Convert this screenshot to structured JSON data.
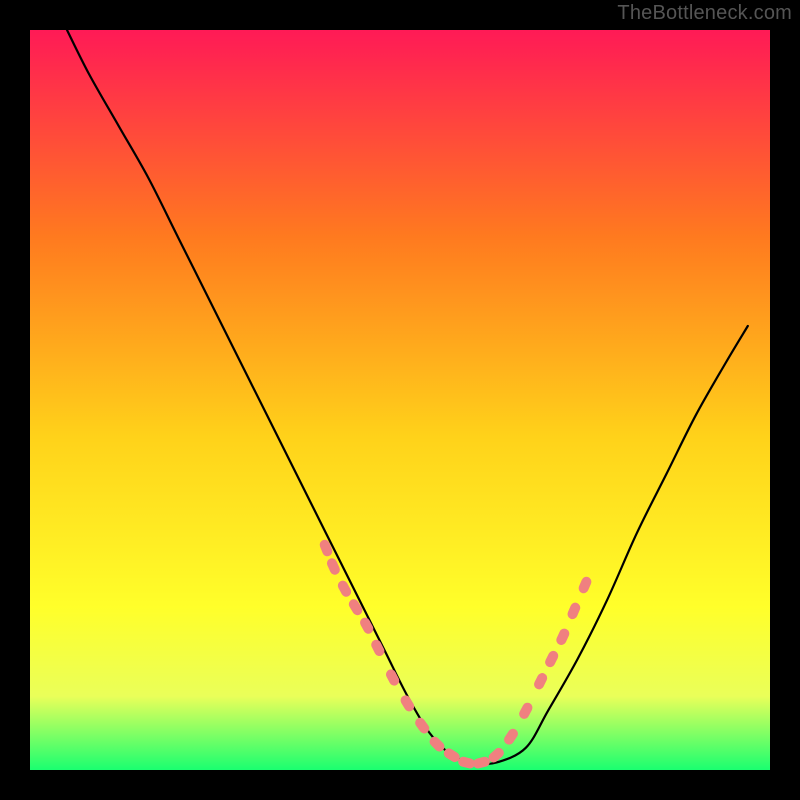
{
  "watermark": "TheBottleneck.com",
  "colors": {
    "gradient_top": "#ff1a56",
    "gradient_mid1": "#ff7a1f",
    "gradient_mid2": "#ffd21a",
    "gradient_mid3": "#ffff2a",
    "gradient_mid4": "#eaff59",
    "gradient_bottom": "#1aff70",
    "curve": "#000000",
    "dot": "#f08080",
    "frame": "#000000"
  },
  "chart_data": {
    "type": "line",
    "title": "",
    "xlabel": "",
    "ylabel": "",
    "xlim": [
      0,
      100
    ],
    "ylim": [
      0,
      100
    ],
    "legend": [],
    "annotations": [],
    "series": [
      {
        "name": "bottleneck-curve",
        "x": [
          5,
          8,
          12,
          16,
          20,
          24,
          28,
          32,
          36,
          40,
          44,
          48,
          51,
          54,
          57,
          60,
          63,
          67,
          70,
          74,
          78,
          82,
          86,
          90,
          94,
          97
        ],
        "y": [
          100,
          94,
          87,
          80,
          72,
          64,
          56,
          48,
          40,
          32,
          24,
          16,
          10,
          5,
          2,
          1,
          1,
          3,
          8,
          15,
          23,
          32,
          40,
          48,
          55,
          60
        ]
      }
    ],
    "overlay_points": {
      "name": "tick-marks",
      "x": [
        40,
        41,
        42.5,
        44,
        45.5,
        47,
        49,
        51,
        53,
        55,
        57,
        59,
        61,
        63,
        65,
        67,
        69,
        70.5,
        72,
        73.5,
        75
      ],
      "y": [
        30,
        27.5,
        24.5,
        22,
        19.5,
        16.5,
        12.5,
        9,
        6,
        3.5,
        2,
        1,
        1,
        2,
        4.5,
        8,
        12,
        15,
        18,
        21.5,
        25
      ]
    }
  }
}
